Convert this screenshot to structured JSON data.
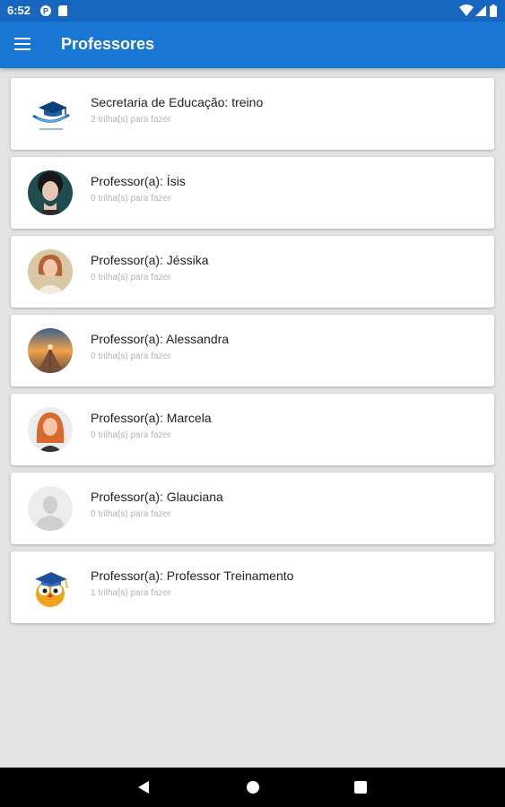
{
  "status_bar": {
    "time": "6:52",
    "icons": [
      "cloud-sync-icon",
      "sd-card-icon",
      "wifi-icon",
      "signal-icon",
      "battery-icon"
    ]
  },
  "app_bar": {
    "title": "Professores",
    "menu_icon": "hamburger-menu-icon"
  },
  "colors": {
    "primary": "#1976d2",
    "status_bar": "#1766c0",
    "background": "#e3e3e3",
    "card": "#ffffff"
  },
  "items": [
    {
      "name": "Secretaria de Educação: treino",
      "subtitle": "2 trilha(s) para fazer",
      "avatar": "graduation-cap-logo"
    },
    {
      "name": "Professor(a): Ísis",
      "subtitle": "0 trilha(s) para fazer",
      "avatar": "profile-photo"
    },
    {
      "name": "Professor(a): Jéssika",
      "subtitle": "0 trilha(s) para fazer",
      "avatar": "profile-photo"
    },
    {
      "name": "Professor(a): Alessandra",
      "subtitle": "0 trilha(s) para fazer",
      "avatar": "landscape-photo"
    },
    {
      "name": "Professor(a): Marcela",
      "subtitle": "0 trilha(s) para fazer",
      "avatar": "profile-photo"
    },
    {
      "name": "Professor(a): Glauciana",
      "subtitle": "0 trilha(s) para fazer",
      "avatar": "default-user-silhouette"
    },
    {
      "name": "Professor(a): Professor Treinamento",
      "subtitle": "1 trilha(s) para fazer",
      "avatar": "owl-mascot"
    }
  ],
  "nav_bar": {
    "buttons": [
      "back-icon",
      "home-icon",
      "recents-icon"
    ]
  }
}
